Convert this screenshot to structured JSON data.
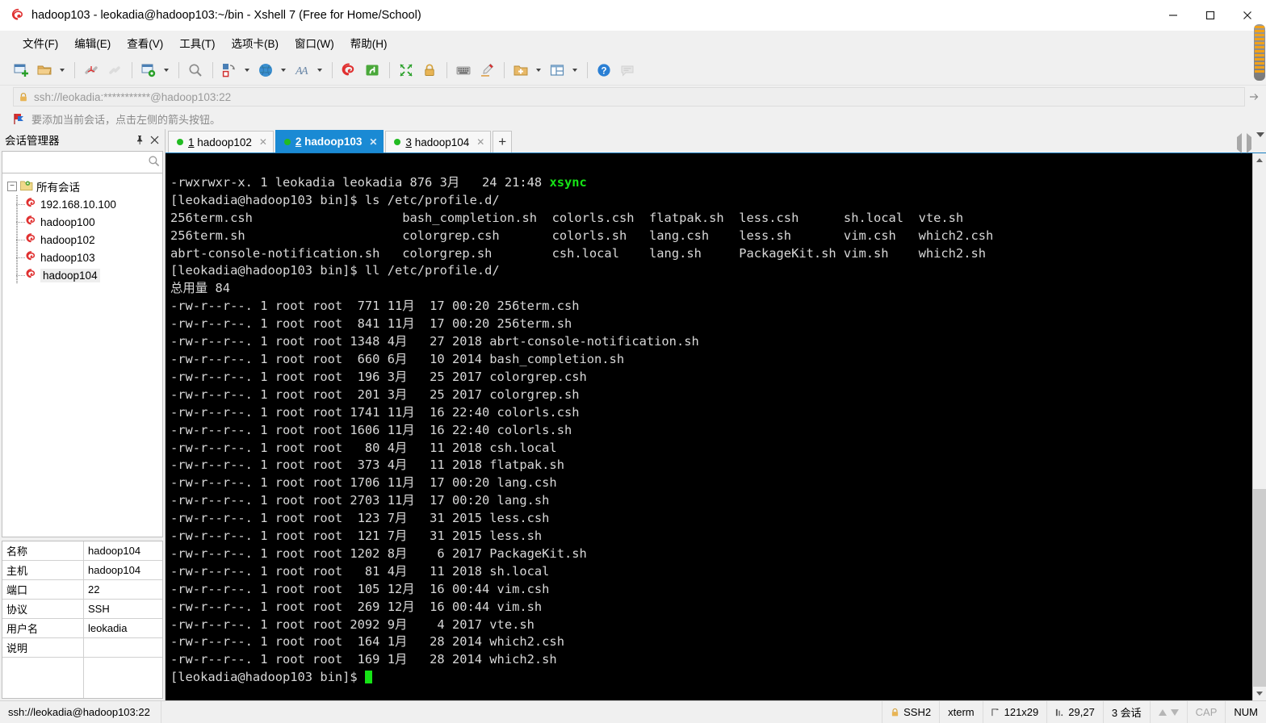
{
  "window": {
    "title": "hadoop103 - leokadia@hadoop103:~/bin - Xshell 7 (Free for Home/School)",
    "minimize": "—",
    "maximize": "□",
    "close": "✕"
  },
  "menu": {
    "items": [
      {
        "label": "文件(F)"
      },
      {
        "label": "编辑(E)"
      },
      {
        "label": "查看(V)"
      },
      {
        "label": "工具(T)"
      },
      {
        "label": "选项卡(B)"
      },
      {
        "label": "窗口(W)"
      },
      {
        "label": "帮助(H)"
      }
    ]
  },
  "toolbar": {
    "buttons": [
      {
        "name": "new-session-icon",
        "title": "新建会话"
      },
      {
        "name": "open-folder-icon",
        "title": "打开"
      },
      {
        "name": "disconnect-icon",
        "title": "断开"
      },
      {
        "name": "reconnect-icon",
        "title": "重新连接"
      },
      {
        "name": "session-properties-icon",
        "title": "属性"
      },
      {
        "name": "find-icon",
        "title": "查找"
      },
      {
        "name": "file-transfer-icon",
        "title": "文件传输"
      },
      {
        "name": "globe-icon",
        "title": "全局"
      },
      {
        "name": "font-icon",
        "title": "字体"
      },
      {
        "name": "xshell-logo-icon",
        "title": "Xshell"
      },
      {
        "name": "xftp-icon",
        "title": "Xftp"
      },
      {
        "name": "fullscreen-icon",
        "title": "全屏"
      },
      {
        "name": "lock-icon",
        "title": "锁定"
      },
      {
        "name": "keyboard-icon",
        "title": "键盘"
      },
      {
        "name": "highlight-icon",
        "title": "高亮"
      },
      {
        "name": "add-folder-icon",
        "title": "添加"
      },
      {
        "name": "layout-icon",
        "title": "布局"
      },
      {
        "name": "help-icon",
        "title": "帮助"
      },
      {
        "name": "comment-icon",
        "title": "注释"
      }
    ]
  },
  "address": {
    "value": "ssh://leokadia:***********@hadoop103:22",
    "lock_icon": "lock-icon",
    "go_icon": "arrow-right-icon"
  },
  "notification": {
    "text": "要添加当前会话，点击左侧的箭头按钮。",
    "icon": "red-flag-icon"
  },
  "sidebar": {
    "title": "会话管理器",
    "pin_icon": "pin-icon",
    "close_icon": "close-icon",
    "search": {
      "value": "",
      "placeholder": "",
      "icon": "search-icon"
    },
    "tree": {
      "root": {
        "label": "所有会话",
        "toggle": "−",
        "icon": "folder-gear-icon"
      },
      "nodes": [
        {
          "label": "192.168.10.100",
          "icon": "xshell-session-icon",
          "selected": false
        },
        {
          "label": "hadoop100",
          "icon": "xshell-session-icon",
          "selected": false
        },
        {
          "label": "hadoop102",
          "icon": "xshell-session-icon",
          "selected": false
        },
        {
          "label": "hadoop103",
          "icon": "xshell-session-icon",
          "selected": false
        },
        {
          "label": "hadoop104",
          "icon": "xshell-session-icon",
          "selected": true
        }
      ]
    },
    "properties": [
      {
        "key": "名称",
        "value": "hadoop104"
      },
      {
        "key": "主机",
        "value": "hadoop104"
      },
      {
        "key": "端口",
        "value": "22"
      },
      {
        "key": "协议",
        "value": "SSH"
      },
      {
        "key": "用户名",
        "value": "leokadia"
      },
      {
        "key": "说明",
        "value": ""
      }
    ]
  },
  "tabs": {
    "items": [
      {
        "index": "1",
        "label": "hadoop102",
        "active": false,
        "close": "✕",
        "status": "connected"
      },
      {
        "index": "2",
        "label": "hadoop103",
        "active": true,
        "close": "✕",
        "status": "connected"
      },
      {
        "index": "3",
        "label": "hadoop104",
        "active": false,
        "close": "✕",
        "status": "connected"
      }
    ],
    "add_label": "+"
  },
  "terminal": {
    "lines": [
      {
        "text": "-rwxrwxr-x. 1 leokadia leokadia 876 3月   24 21:48 ",
        "highlight": "xsync"
      },
      {
        "text": "[leokadia@hadoop103 bin]$ ls /etc/profile.d/"
      },
      {
        "text": "256term.csh                    bash_completion.sh  colorls.csh  flatpak.sh  less.csh      sh.local  vte.sh"
      },
      {
        "text": "256term.sh                     colorgrep.csh       colorls.sh   lang.csh    less.sh       vim.csh   which2.csh"
      },
      {
        "text": "abrt-console-notification.sh   colorgrep.sh        csh.local    lang.sh     PackageKit.sh vim.sh    which2.sh"
      },
      {
        "text": "[leokadia@hadoop103 bin]$ ll /etc/profile.d/"
      },
      {
        "text": "总用量 84"
      },
      {
        "text": "-rw-r--r--. 1 root root  771 11月  17 00:20 256term.csh"
      },
      {
        "text": "-rw-r--r--. 1 root root  841 11月  17 00:20 256term.sh"
      },
      {
        "text": "-rw-r--r--. 1 root root 1348 4月   27 2018 abrt-console-notification.sh"
      },
      {
        "text": "-rw-r--r--. 1 root root  660 6月   10 2014 bash_completion.sh"
      },
      {
        "text": "-rw-r--r--. 1 root root  196 3月   25 2017 colorgrep.csh"
      },
      {
        "text": "-rw-r--r--. 1 root root  201 3月   25 2017 colorgrep.sh"
      },
      {
        "text": "-rw-r--r--. 1 root root 1741 11月  16 22:40 colorls.csh"
      },
      {
        "text": "-rw-r--r--. 1 root root 1606 11月  16 22:40 colorls.sh"
      },
      {
        "text": "-rw-r--r--. 1 root root   80 4月   11 2018 csh.local"
      },
      {
        "text": "-rw-r--r--. 1 root root  373 4月   11 2018 flatpak.sh"
      },
      {
        "text": "-rw-r--r--. 1 root root 1706 11月  17 00:20 lang.csh"
      },
      {
        "text": "-rw-r--r--. 1 root root 2703 11月  17 00:20 lang.sh"
      },
      {
        "text": "-rw-r--r--. 1 root root  123 7月   31 2015 less.csh"
      },
      {
        "text": "-rw-r--r--. 1 root root  121 7月   31 2015 less.sh"
      },
      {
        "text": "-rw-r--r--. 1 root root 1202 8月    6 2017 PackageKit.sh"
      },
      {
        "text": "-rw-r--r--. 1 root root   81 4月   11 2018 sh.local"
      },
      {
        "text": "-rw-r--r--. 1 root root  105 12月  16 00:44 vim.csh"
      },
      {
        "text": "-rw-r--r--. 1 root root  269 12月  16 00:44 vim.sh"
      },
      {
        "text": "-rw-r--r--. 1 root root 2092 9月    4 2017 vte.sh"
      },
      {
        "text": "-rw-r--r--. 1 root root  164 1月   28 2014 which2.csh"
      },
      {
        "text": "-rw-r--r--. 1 root root  169 1月   28 2014 which2.sh"
      }
    ],
    "prompt": "[leokadia@hadoop103 bin]$ "
  },
  "statusbar": {
    "connection": "ssh://leokadia@hadoop103:22",
    "protocol": "SSH2",
    "terminal_type": "xterm",
    "size": "121x29",
    "cursor": "29,27",
    "sessions": "3 会话",
    "cap": "CAP",
    "num": "NUM",
    "lock_icon": "lock-icon",
    "size_icon": "resize-icon",
    "cursor_icon": "cursor-icon"
  },
  "colors": {
    "accent": "#1a8ad4",
    "terminal_bg": "#000000",
    "terminal_fg": "#d8d8d8",
    "highlight_green": "#16e316",
    "chrome": "#f0f0f0"
  }
}
